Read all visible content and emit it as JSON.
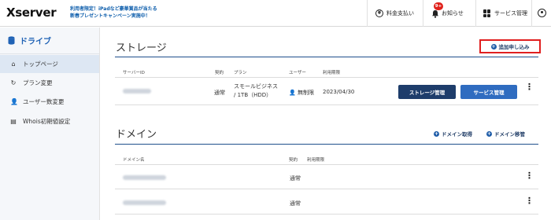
{
  "header": {
    "logo": "Xserver",
    "promo_line1": "利用者限定！iPadなど豪華賞品が当たる",
    "promo_line2": "新春プレゼントキャンペーン実施中！",
    "payment_label": "料金支払い",
    "notifications_label": "お知らせ",
    "notification_badge": "9+",
    "service_admin_label": "サービス管理"
  },
  "sidebar": {
    "title": "ドライブ",
    "items": [
      {
        "label": "トップページ",
        "icon": "home-icon",
        "active": true
      },
      {
        "label": "プラン変更",
        "icon": "refresh-icon",
        "active": false
      },
      {
        "label": "ユーザー数変更",
        "icon": "users-icon",
        "active": false
      },
      {
        "label": "Whois初期値設定",
        "icon": "document-icon",
        "active": false
      }
    ]
  },
  "storage": {
    "title": "ストレージ",
    "add_label": "追加申し込み",
    "columns": [
      "サーバーID",
      "契約",
      "プラン",
      "ユーザー",
      "利用期限"
    ],
    "row": {
      "contract": "通常",
      "plan_line1": "スモールビジネス",
      "plan_line2": "/ 1TB（HDD）",
      "users": "無制限",
      "expiry": "2023/04/30",
      "storage_manage_label": "ストレージ管理",
      "service_manage_label": "サービス管理"
    }
  },
  "domain": {
    "title": "ドメイン",
    "acquire_label": "ドメイン取得",
    "transfer_label": "ドメイン移管",
    "columns": [
      "ドメイン名",
      "契約",
      "利用期限"
    ],
    "rows": [
      {
        "contract": "通常"
      },
      {
        "contract": "通常"
      }
    ]
  },
  "colors": {
    "accent_dark": "#1e3d6b",
    "accent_blue": "#2f6cc0",
    "highlight_red": "#e01f1f"
  }
}
